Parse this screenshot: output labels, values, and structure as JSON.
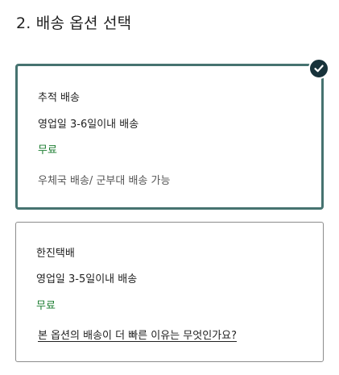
{
  "section": {
    "title": "2. 배송 옵션 선택"
  },
  "options": [
    {
      "name": "추적 배송",
      "duration": "영업일 3-6일이내 배송",
      "price": "무료",
      "note": "우체국 배송/ 군부대 배송 가능",
      "selected": true
    },
    {
      "name": "한진택배",
      "duration": "영업일 3-5일이내 배송",
      "price": "무료",
      "link": "본 옵션의 배송이 더 빠른 이유는 무엇인가요?",
      "selected": false
    }
  ],
  "colors": {
    "selected_border": "#467370",
    "check_badge": "#17323a",
    "price_green": "#1b7c30"
  },
  "icons": {
    "selected_indicator": "checkmark-icon"
  }
}
